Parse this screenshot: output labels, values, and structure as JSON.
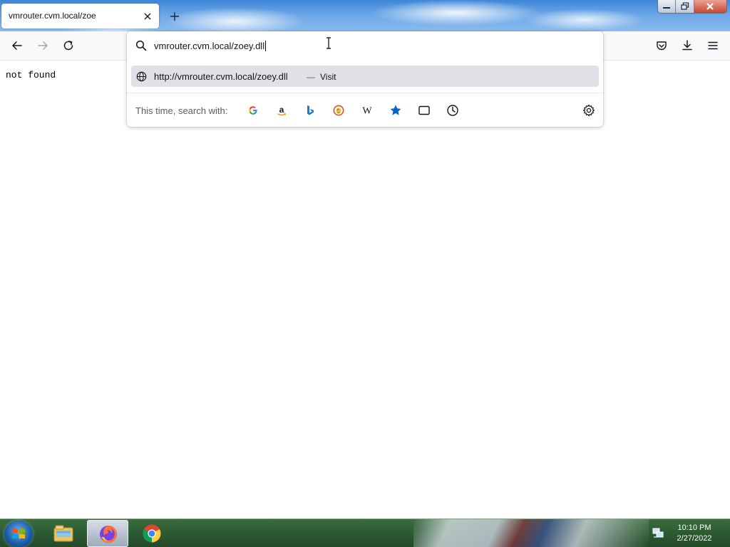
{
  "browser": {
    "tab": {
      "title": "vmrouter.cvm.local/zoe"
    }
  },
  "page": {
    "content_text": "not found"
  },
  "urlbar": {
    "input_value": "vmrouter.cvm.local/zoey.dll",
    "suggestion": {
      "url": "http://vmrouter.cvm.local/zoey.dll",
      "separator": "—",
      "action": "Visit"
    },
    "oneoff": {
      "label": "This time, search with:",
      "engines": [
        "google-icon",
        "amazon-icon",
        "bing-icon",
        "duckduckgo-icon",
        "wikipedia-icon",
        "bookmarks-icon",
        "tabs-icon",
        "history-icon"
      ]
    }
  },
  "taskbar": {
    "items": [
      "windows-explorer-icon",
      "firefox-icon",
      "chrome-icon"
    ],
    "clock": {
      "time": "10:10 PM",
      "date": "2/27/2022"
    }
  }
}
